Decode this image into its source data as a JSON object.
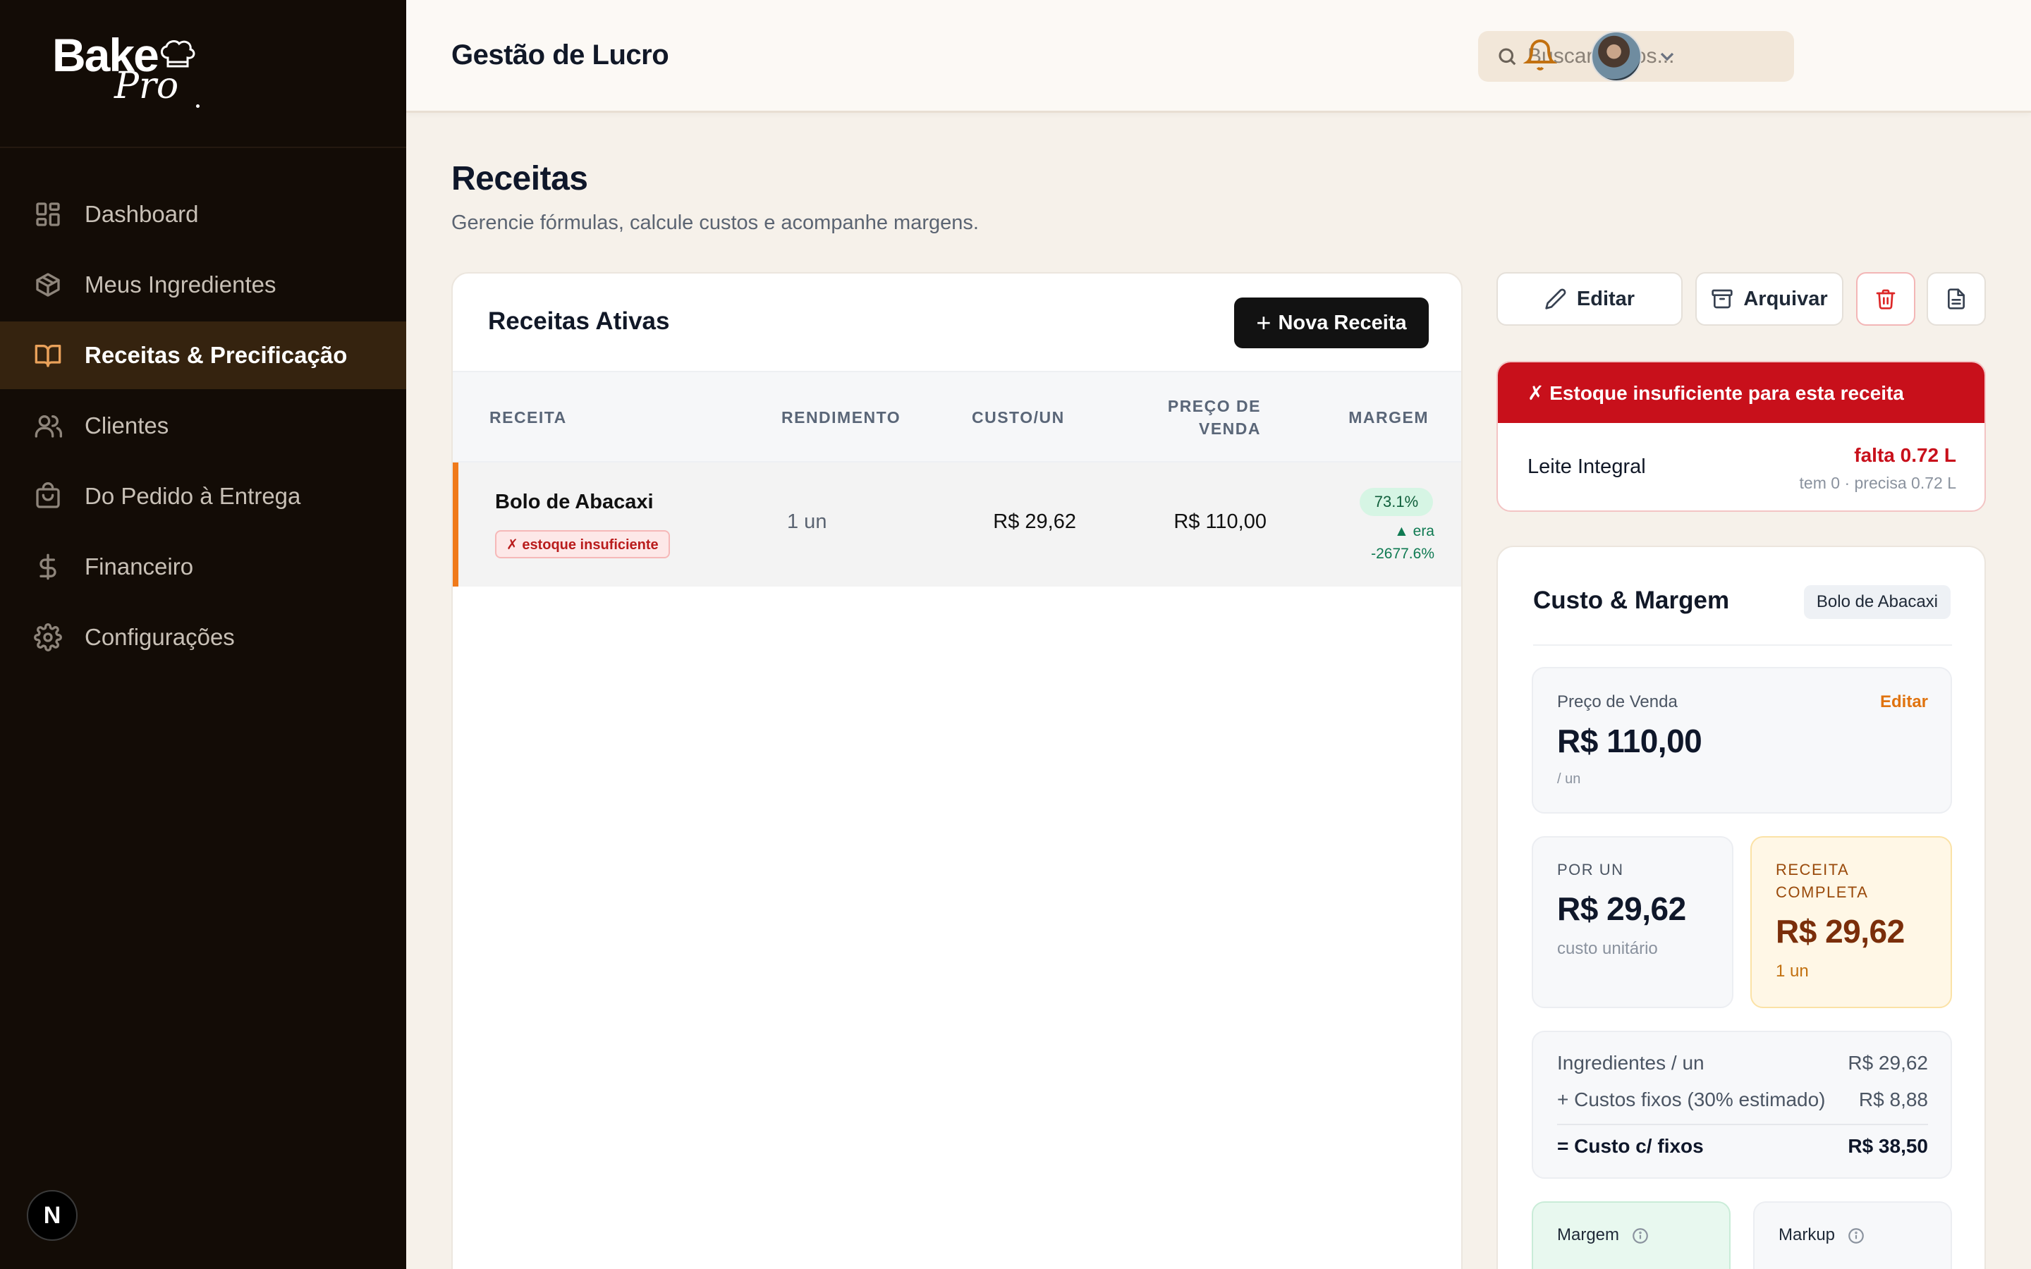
{
  "sidebar": {
    "logo_text": "Bake",
    "logo_script": "Pro",
    "items": [
      {
        "label": "Dashboard",
        "icon": "dashboard-icon"
      },
      {
        "label": "Meus Ingredientes",
        "icon": "package-icon"
      },
      {
        "label": "Receitas & Precificação",
        "icon": "book-open-icon",
        "active": true
      },
      {
        "label": "Clientes",
        "icon": "users-icon"
      },
      {
        "label": "Do Pedido à Entrega",
        "icon": "shopping-bag-icon"
      },
      {
        "label": "Financeiro",
        "icon": "dollar-icon"
      },
      {
        "label": "Configurações",
        "icon": "gear-icon"
      }
    ],
    "badge": "N"
  },
  "topbar": {
    "title": "Gestão de Lucro",
    "search_placeholder": "Buscar dados..."
  },
  "page": {
    "title": "Receitas",
    "subtitle": "Gerencie fórmulas, calcule custos e acompanhe margens."
  },
  "table": {
    "title": "Receitas Ativas",
    "new_button": "Nova Receita",
    "columns": [
      "RECEITA",
      "RENDIMENTO",
      "CUSTO/UN",
      "PREÇO DE VENDA",
      "MARGEM"
    ],
    "rows": [
      {
        "name": "Bolo de Abacaxi",
        "badge": "✗ estoque insuficiente",
        "rendimento": "1 un",
        "custo": "R$ 29,62",
        "preco": "R$ 110,00",
        "margem": "73.1%",
        "era": "▲ era",
        "era_value": "-2677.6%"
      }
    ]
  },
  "actions": {
    "edit": "Editar",
    "archive": "Arquivar"
  },
  "alert": {
    "title": "✗ Estoque insuficiente para esta receita",
    "item": "Leite Integral",
    "falta": "falta 0.72 L",
    "info": "tem 0 · precisa 0.72 L"
  },
  "cost": {
    "title": "Custo & Margem",
    "tag": "Bolo de Abacaxi",
    "price_label": "Preço de Venda",
    "price_edit": "Editar",
    "price_value": "R$ 110,00",
    "price_unit": "/ un",
    "per_un_label": "POR UN",
    "per_un_value": "R$ 29,62",
    "per_un_sub": "custo unitário",
    "full_label_1": "RECEITA",
    "full_label_2": "COMPLETA",
    "full_value": "R$ 29,62",
    "full_sub": "1 un",
    "ing_label": "Ingredientes / un",
    "ing_value": "R$ 29,62",
    "fixed_label": "+ Custos fixos (30% estimado)",
    "fixed_value": "R$ 8,88",
    "total_label": "= Custo c/ fixos",
    "total_value": "R$ 38,50",
    "margin_label": "Margem",
    "markup_label": "Markup"
  },
  "colors": {
    "sidebar_bg": "#130c06",
    "active_bg": "#35230f",
    "accent": "#f07a1a",
    "alert_red": "#c8101b",
    "primary_button": "#121212"
  }
}
